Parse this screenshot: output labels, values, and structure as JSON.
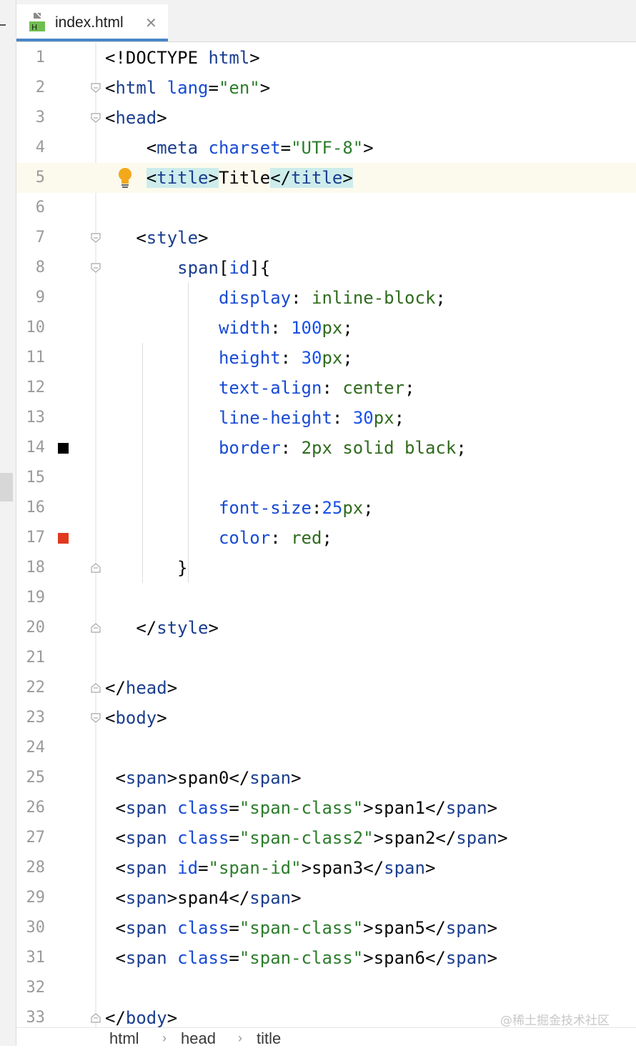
{
  "tab": {
    "label": "index.html",
    "close": "✕",
    "file_icon_letter": "H"
  },
  "swatch_colors": {
    "black": "#000000",
    "red": "#e0391e"
  },
  "lines": [
    {
      "n": "1",
      "segs": [
        [
          "p",
          "<!DOCTYPE "
        ],
        [
          "tag",
          "html"
        ],
        [
          "p",
          ">"
        ]
      ]
    },
    {
      "n": "2",
      "segs": [
        [
          "p",
          "<"
        ],
        [
          "tag",
          "html "
        ],
        [
          "attr",
          "lang"
        ],
        [
          "p",
          "="
        ],
        [
          "str",
          "\"en\""
        ],
        [
          "p",
          ">"
        ]
      ]
    },
    {
      "n": "3",
      "segs": [
        [
          "p",
          "<"
        ],
        [
          "tag",
          "head"
        ],
        [
          "p",
          ">"
        ]
      ]
    },
    {
      "n": "4",
      "segs": [
        [
          "p",
          "    <"
        ],
        [
          "tag",
          "meta "
        ],
        [
          "attr",
          "charset"
        ],
        [
          "p",
          "="
        ],
        [
          "str",
          "\"UTF-8\""
        ],
        [
          "p",
          ">"
        ]
      ]
    },
    {
      "n": "5",
      "segs": [
        [
          "p",
          "    "
        ],
        [
          "hl",
          "<"
        ],
        [
          "hltag",
          "title"
        ],
        [
          "hl",
          ">"
        ],
        [
          "p",
          "Title"
        ],
        [
          "hl",
          "</"
        ],
        [
          "hltag",
          "title"
        ],
        [
          "hl",
          ">"
        ]
      ]
    },
    {
      "n": "6",
      "segs": []
    },
    {
      "n": "7",
      "segs": [
        [
          "p",
          "   <"
        ],
        [
          "tag",
          "style"
        ],
        [
          "p",
          ">"
        ]
      ]
    },
    {
      "n": "8",
      "segs": [
        [
          "p",
          "       "
        ],
        [
          "tag",
          "span"
        ],
        [
          "p",
          "["
        ],
        [
          "attr",
          "id"
        ],
        [
          "p",
          "]{"
        ]
      ]
    },
    {
      "n": "9",
      "segs": [
        [
          "p",
          "           "
        ],
        [
          "prop",
          "display"
        ],
        [
          "p",
          ": "
        ],
        [
          "val",
          "inline-block"
        ],
        [
          "p",
          ";"
        ]
      ]
    },
    {
      "n": "10",
      "segs": [
        [
          "p",
          "           "
        ],
        [
          "prop",
          "width"
        ],
        [
          "p",
          ": "
        ],
        [
          "num",
          "100"
        ],
        [
          "val",
          "px"
        ],
        [
          "p",
          ";"
        ]
      ]
    },
    {
      "n": "11",
      "segs": [
        [
          "p",
          "           "
        ],
        [
          "prop",
          "height"
        ],
        [
          "p",
          ": "
        ],
        [
          "num",
          "30"
        ],
        [
          "val",
          "px"
        ],
        [
          "p",
          ";"
        ]
      ]
    },
    {
      "n": "12",
      "segs": [
        [
          "p",
          "           "
        ],
        [
          "prop",
          "text-align"
        ],
        [
          "p",
          ": "
        ],
        [
          "val",
          "center"
        ],
        [
          "p",
          ";"
        ]
      ]
    },
    {
      "n": "13",
      "segs": [
        [
          "p",
          "           "
        ],
        [
          "prop",
          "line-height"
        ],
        [
          "p",
          ": "
        ],
        [
          "num",
          "30"
        ],
        [
          "val",
          "px"
        ],
        [
          "p",
          ";"
        ]
      ]
    },
    {
      "n": "14",
      "segs": [
        [
          "p",
          "           "
        ],
        [
          "prop",
          "border"
        ],
        [
          "p",
          ": "
        ],
        [
          "val",
          "2px solid black"
        ],
        [
          "p",
          ";"
        ]
      ]
    },
    {
      "n": "15",
      "segs": []
    },
    {
      "n": "16",
      "segs": [
        [
          "p",
          "           "
        ],
        [
          "prop",
          "font-size"
        ],
        [
          "p",
          ":"
        ],
        [
          "num",
          "25"
        ],
        [
          "val",
          "px"
        ],
        [
          "p",
          ";"
        ]
      ]
    },
    {
      "n": "17",
      "segs": [
        [
          "p",
          "           "
        ],
        [
          "prop",
          "color"
        ],
        [
          "p",
          ": "
        ],
        [
          "val",
          "red"
        ],
        [
          "p",
          ";"
        ]
      ]
    },
    {
      "n": "18",
      "segs": [
        [
          "p",
          "       }"
        ]
      ]
    },
    {
      "n": "19",
      "segs": []
    },
    {
      "n": "20",
      "segs": [
        [
          "p",
          "   </"
        ],
        [
          "tag",
          "style"
        ],
        [
          "p",
          ">"
        ]
      ]
    },
    {
      "n": "21",
      "segs": []
    },
    {
      "n": "22",
      "segs": [
        [
          "p",
          "</"
        ],
        [
          "tag",
          "head"
        ],
        [
          "p",
          ">"
        ]
      ]
    },
    {
      "n": "23",
      "segs": [
        [
          "p",
          "<"
        ],
        [
          "tag",
          "body"
        ],
        [
          "p",
          ">"
        ]
      ]
    },
    {
      "n": "24",
      "segs": []
    },
    {
      "n": "25",
      "segs": [
        [
          "p",
          " <"
        ],
        [
          "tag",
          "span"
        ],
        [
          "p",
          ">span0</"
        ],
        [
          "tag",
          "span"
        ],
        [
          "p",
          ">"
        ]
      ]
    },
    {
      "n": "26",
      "segs": [
        [
          "p",
          " <"
        ],
        [
          "tag",
          "span "
        ],
        [
          "attr",
          "class"
        ],
        [
          "p",
          "="
        ],
        [
          "str",
          "\"span-class\""
        ],
        [
          "p",
          ">span1</"
        ],
        [
          "tag",
          "span"
        ],
        [
          "p",
          ">"
        ]
      ]
    },
    {
      "n": "27",
      "segs": [
        [
          "p",
          " <"
        ],
        [
          "tag",
          "span "
        ],
        [
          "attr",
          "class"
        ],
        [
          "p",
          "="
        ],
        [
          "str",
          "\"span-class2\""
        ],
        [
          "p",
          ">span2</"
        ],
        [
          "tag",
          "span"
        ],
        [
          "p",
          ">"
        ]
      ]
    },
    {
      "n": "28",
      "segs": [
        [
          "p",
          " <"
        ],
        [
          "tag",
          "span "
        ],
        [
          "attr",
          "id"
        ],
        [
          "p",
          "="
        ],
        [
          "str",
          "\"span-id\""
        ],
        [
          "p",
          ">span3</"
        ],
        [
          "tag",
          "span"
        ],
        [
          "p",
          ">"
        ]
      ]
    },
    {
      "n": "29",
      "segs": [
        [
          "p",
          " <"
        ],
        [
          "tag",
          "span"
        ],
        [
          "p",
          ">span4</"
        ],
        [
          "tag",
          "span"
        ],
        [
          "p",
          ">"
        ]
      ]
    },
    {
      "n": "30",
      "segs": [
        [
          "p",
          " <"
        ],
        [
          "tag",
          "span "
        ],
        [
          "attr",
          "class"
        ],
        [
          "p",
          "="
        ],
        [
          "str",
          "\"span-class\""
        ],
        [
          "p",
          ">span5</"
        ],
        [
          "tag",
          "span"
        ],
        [
          "p",
          ">"
        ]
      ]
    },
    {
      "n": "31",
      "segs": [
        [
          "p",
          " <"
        ],
        [
          "tag",
          "span "
        ],
        [
          "attr",
          "class"
        ],
        [
          "p",
          "="
        ],
        [
          "str",
          "\"span-class\""
        ],
        [
          "p",
          ">span6</"
        ],
        [
          "tag",
          "span"
        ],
        [
          "p",
          ">"
        ]
      ]
    },
    {
      "n": "32",
      "segs": []
    },
    {
      "n": "33",
      "segs": [
        [
          "p",
          "</"
        ],
        [
          "tag",
          "body"
        ],
        [
          "p",
          ">"
        ]
      ]
    }
  ],
  "breadcrumbs": [
    "html",
    "head",
    "title"
  ],
  "breadcrumb_separator": "›",
  "watermark": "@稀土掘金技术社区"
}
